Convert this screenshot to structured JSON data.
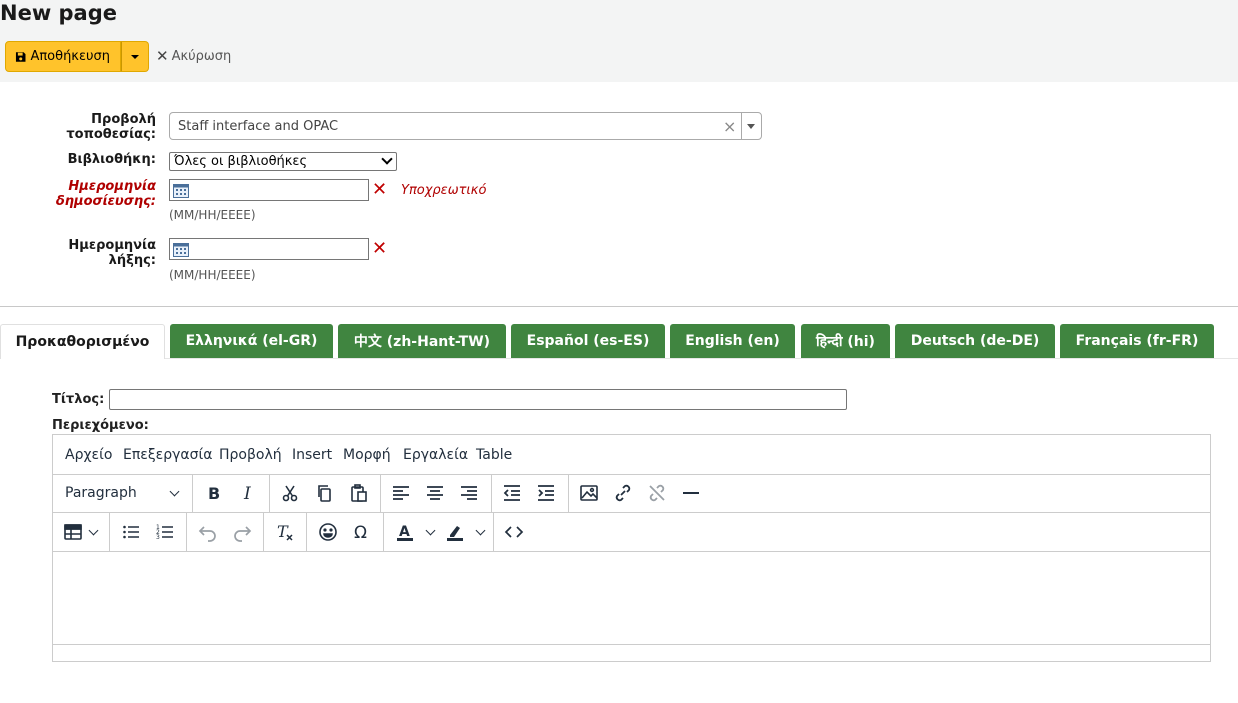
{
  "page": {
    "title": "New page"
  },
  "toolbar": {
    "save_label": "Αποθήκευση",
    "cancel_label": "Ακύρωση"
  },
  "form": {
    "location_label_line1": "Προβολή",
    "location_label_line2": "τοποθεσίας:",
    "location_value": "Staff interface and OPAC",
    "library_label": "Βιβλιοθήκη:",
    "library_value": "Όλες οι βιβλιοθήκες",
    "pubdate_label_line1": "Ημερομηνία",
    "pubdate_label_line2": "δημοσίευσης:",
    "pubdate_required": "Υποχρεωτικό",
    "pubdate_hint": "(MM/HH/EEEE)",
    "expdate_label_line1": "Ημερομηνία",
    "expdate_label_line2": "λήξης:",
    "expdate_hint": "(MM/HH/EEEE)"
  },
  "tabs": [
    {
      "label": "Προκαθορισμένο",
      "active": true
    },
    {
      "label": "Ελληνικά (el-GR)"
    },
    {
      "label": "中文 (zh-Hant-TW)"
    },
    {
      "label": "Español (es-ES)"
    },
    {
      "label": "English (en)"
    },
    {
      "label": "हिन्दी (hi)"
    },
    {
      "label": "Deutsch (de-DE)"
    },
    {
      "label": "Français (fr-FR)"
    }
  ],
  "content": {
    "title_label": "Τίτλος:",
    "content_label": "Περιεχόμενο:"
  },
  "editor": {
    "menu": [
      "Αρχείο",
      "Επεξεργασία",
      "Προβολή",
      "Insert",
      "Μορφή",
      "Εργαλεία",
      "Table"
    ],
    "block_format": "Paragraph"
  },
  "colors": {
    "save_button": "#ffc32b",
    "tab_green": "#408540",
    "required_red": "#b00000"
  }
}
